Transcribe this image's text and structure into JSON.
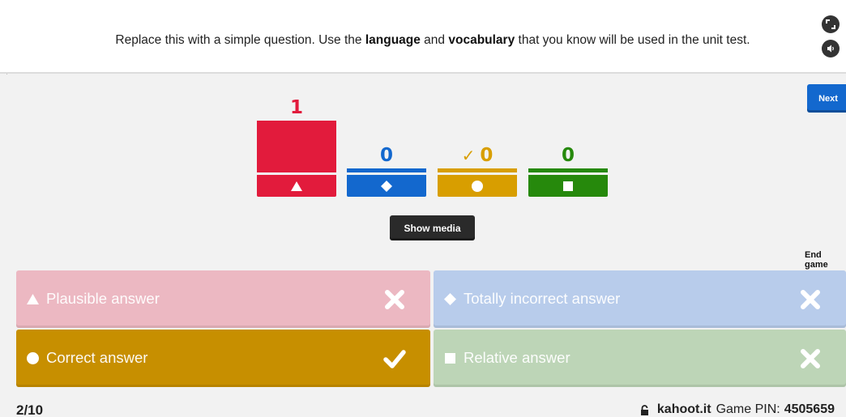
{
  "question": {
    "parts": [
      {
        "text": "Replace this with a simple question. Use the ",
        "bold": false
      },
      {
        "text": "language",
        "bold": true
      },
      {
        "text": " and ",
        "bold": false
      },
      {
        "text": "vocabulary",
        "bold": true
      },
      {
        "text": " that you know will be used in the unit test.",
        "bold": false
      }
    ]
  },
  "header_buttons": {
    "fullscreen_icon": "fullscreen-icon",
    "sound_icon": "volume-icon"
  },
  "next_label": "Next",
  "results": [
    {
      "count": "1",
      "value": 1,
      "shape": "triangle",
      "color": "#e21b3c",
      "correct": false
    },
    {
      "count": "0",
      "value": 0,
      "shape": "diamond",
      "color": "#1368ce",
      "correct": false
    },
    {
      "count": "0",
      "value": 0,
      "shape": "circle",
      "color": "#d89e00",
      "correct": true,
      "check": "✓"
    },
    {
      "count": "0",
      "value": 0,
      "shape": "square",
      "color": "#26890c",
      "correct": false
    }
  ],
  "show_media_label": "Show media",
  "end_game_label": "End game",
  "answers": [
    {
      "label": "Plausible answer",
      "shape": "triangle",
      "bg": "#ecb8c2",
      "result": "incorrect",
      "mark_icon": "cross-icon"
    },
    {
      "label": "Totally incorrect answer",
      "shape": "diamond",
      "bg": "#b8cceb",
      "result": "incorrect",
      "mark_icon": "cross-icon"
    },
    {
      "label": "Correct answer",
      "shape": "circle",
      "bg": "#c78f00",
      "result": "correct",
      "mark_icon": "check-icon"
    },
    {
      "label": "Relative answer",
      "shape": "square",
      "bg": "#bdd5b7",
      "result": "incorrect",
      "mark_icon": "cross-icon"
    }
  ],
  "footer": {
    "progress": "2/10",
    "site": "kahoot.it",
    "pin_label": "Game PIN:",
    "pin": "4505659"
  }
}
